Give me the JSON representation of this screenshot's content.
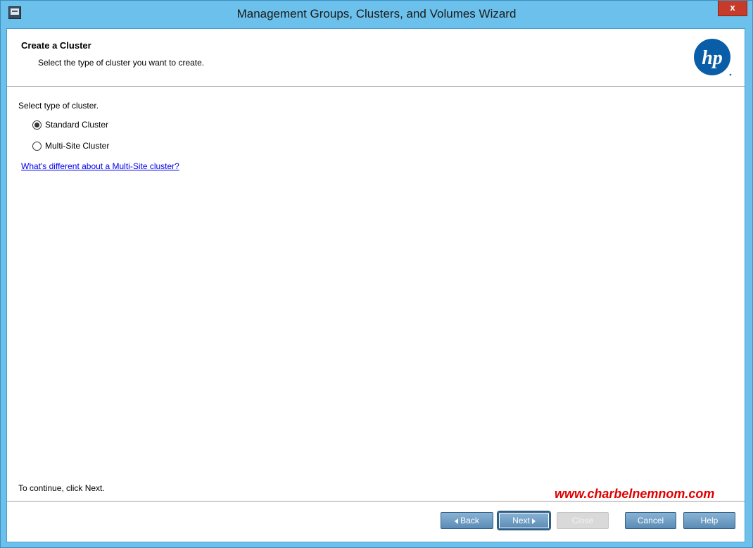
{
  "window": {
    "title": "Management Groups, Clusters, and Volumes Wizard",
    "close_label": "x"
  },
  "header": {
    "title": "Create a Cluster",
    "subtitle": "Select the type of cluster you want to create.",
    "logo_text": "hp"
  },
  "content": {
    "prompt": "Select type of cluster.",
    "options": [
      {
        "label": "Standard Cluster",
        "checked": true
      },
      {
        "label": "Multi-Site Cluster",
        "checked": false
      }
    ],
    "help_link": "What's different about a Multi-Site cluster?",
    "status": "To continue, click Next."
  },
  "watermark": "www.charbelnemnom.com",
  "buttons": {
    "back": "Back",
    "next": "Next",
    "close": "Close",
    "cancel": "Cancel",
    "help": "Help"
  },
  "colors": {
    "frame": "#6cc1ec",
    "close_button": "#c73b2b",
    "button_blue": "#5a8cb6",
    "link": "#0000ee",
    "watermark": "#e00000"
  }
}
